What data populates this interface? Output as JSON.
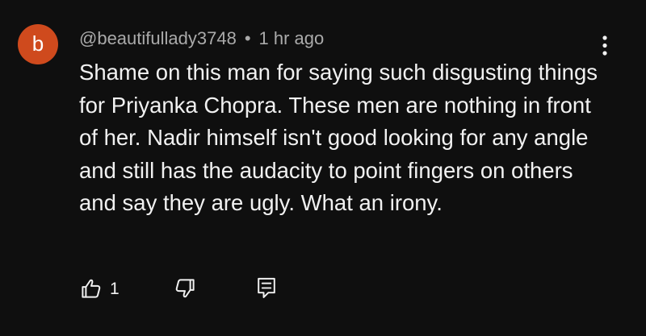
{
  "comment": {
    "avatar_letter": "b",
    "avatar_color": "#cf4a1d",
    "author": "@beautifullady3748",
    "separator": "•",
    "time": "1 hr ago",
    "text": "Shame on this man for saying such disgusting things for Priyanka Chopra. These men are nothing in front of her. Nadir himself isn't good looking for any angle and still has the audacity to point fingers on others and say they are ugly. What an irony.",
    "menu_icon": "vertical-dots-icon",
    "actions": {
      "like_icon": "thumbs-up-icon",
      "like_count": "1",
      "dislike_icon": "thumbs-down-icon",
      "reply_icon": "reply-icon"
    }
  },
  "colors": {
    "background": "#0f0f0f",
    "text": "#f1f1f1",
    "meta": "#aaaaaa"
  }
}
